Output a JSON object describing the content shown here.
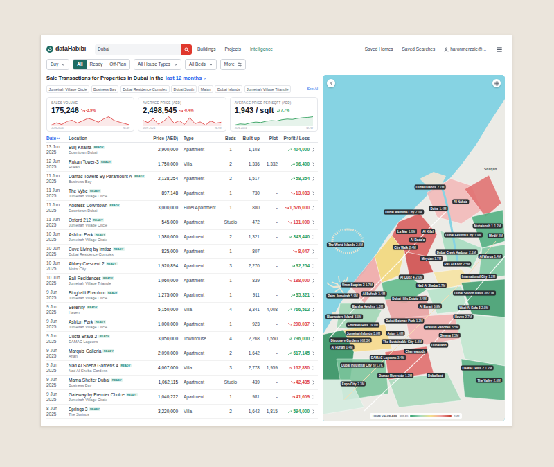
{
  "brand": {
    "name": "dataHabibi"
  },
  "search": {
    "value": "Dubai"
  },
  "nav": [
    {
      "label": "Buildings",
      "selected": false
    },
    {
      "label": "Projects",
      "selected": false
    },
    {
      "label": "Intelligence",
      "selected": true
    }
  ],
  "account": {
    "links": [
      "Saved Homes",
      "Saved Searches"
    ],
    "user": "haronmerzaie@..."
  },
  "filters": {
    "deal": "Buy",
    "statuses": [
      {
        "label": "All",
        "selected": true
      },
      {
        "label": "Ready",
        "selected": false
      },
      {
        "label": "Off-Plan",
        "selected": false
      }
    ],
    "dropdowns": [
      "All House Types",
      "All Beds"
    ],
    "more": "More"
  },
  "heading": {
    "text": "Sale Transactions for Properties in Dubai in the",
    "period": "last 12 months"
  },
  "chips": [
    "Jumeirah Village Circle",
    "Business Bay",
    "Dubai Residence Complex",
    "Dubai South",
    "Majan",
    "Dubai Islands",
    "Jumeirah Village Triangle"
  ],
  "see_all": "See Al",
  "stats": [
    {
      "label": "SALES VOLUME",
      "value": "175,246",
      "change": "-3.9%",
      "trend": "down",
      "color": "#e04848",
      "axis_start": "JUN 2024",
      "axis_end": "NOW",
      "series": [
        12800,
        13900,
        13100,
        14600,
        15200,
        13800,
        14900,
        16100,
        15400,
        14200,
        15800,
        16900,
        15100,
        14300,
        13600,
        12900
      ]
    },
    {
      "label": "AVERAGE PRICE (AED)",
      "value": "2,498,545",
      "change": "-0.4%",
      "trend": "down",
      "color": "#e04848",
      "axis_start": "JUN 2024",
      "axis_end": "NOW",
      "series": [
        2540000,
        2490000,
        2575000,
        2460000,
        2520000,
        2610000,
        2480000,
        2530000,
        2455000,
        2590000,
        2470000,
        2505000,
        2440000,
        2525000,
        2480000,
        2498545
      ]
    },
    {
      "label": "AVERAGE PRICE PER SQFT (AED)",
      "value": "1,943 / sqft",
      "change": "7.7%",
      "trend": "up",
      "color": "#2f9e5b",
      "axis_start": "JUN 2024",
      "axis_end": "NOW",
      "series": [
        1790,
        1812,
        1805,
        1830,
        1846,
        1838,
        1861,
        1872,
        1866,
        1889,
        1901,
        1895,
        1912,
        1925,
        1931,
        1943
      ]
    }
  ],
  "table": {
    "columns": [
      {
        "label": "Date",
        "sorted": true
      },
      {
        "label": "Location",
        "sorted": false
      },
      {
        "label": "Price (AED)",
        "sorted": false
      },
      {
        "label": "Type",
        "sorted": false
      },
      {
        "label": "Beds",
        "sorted": false
      },
      {
        "label": "Built-up",
        "sorted": false
      },
      {
        "label": "Plot",
        "sorted": false
      },
      {
        "label": "Profit / Loss",
        "sorted": false
      }
    ],
    "rows": [
      {
        "date": "13 Jun",
        "year": "2025",
        "name": "Burj Khalifa",
        "badge": "READY",
        "area": "Downtown Dubai",
        "price": "2,900,000",
        "type": "Apartment",
        "beds": "1",
        "built_up": "1,103",
        "plot": "-",
        "profit": "404,000",
        "kind": "profit"
      },
      {
        "date": "12 Jun",
        "year": "2025",
        "name": "Rukan Tower-3",
        "badge": "READY",
        "area": "Rukan",
        "price": "1,750,000",
        "type": "Villa",
        "beds": "2",
        "built_up": "1,336",
        "plot": "1,332",
        "profit": "96,400",
        "kind": "profit"
      },
      {
        "date": "11 Jun",
        "year": "2025",
        "name": "Damac Towers By Paramount A",
        "badge": "READY",
        "area": "Business Bay",
        "price": "2,138,254",
        "type": "Apartment",
        "beds": "2",
        "built_up": "1,517",
        "plot": "-",
        "profit": "58,254",
        "kind": "profit"
      },
      {
        "date": "11 Jun",
        "year": "2025",
        "name": "The Vybe",
        "badge": "READY",
        "area": "Jumeirah Village Circle",
        "price": "897,148",
        "type": "Apartment",
        "beds": "1",
        "built_up": "730",
        "plot": "-",
        "profit": "13,083",
        "kind": "loss"
      },
      {
        "date": "11 Jun",
        "year": "2025",
        "name": "Address Downtown",
        "badge": "READY",
        "area": "Downtown Dubai",
        "price": "3,000,000",
        "type": "Hotel Apartment",
        "beds": "1",
        "built_up": "880",
        "plot": "-",
        "profit": "1,576,000",
        "kind": "loss"
      },
      {
        "date": "11 Jun",
        "year": "2025",
        "name": "Oxford 212",
        "badge": "READY",
        "area": "Jumeirah Village Circle",
        "price": "545,000",
        "type": "Apartment",
        "beds": "Studio",
        "built_up": "472",
        "plot": "-",
        "profit": "131,000",
        "kind": "loss"
      },
      {
        "date": "10 Jun",
        "year": "2025",
        "name": "Ashton Park",
        "badge": "READY",
        "area": "Jumeirah Village Circle",
        "price": "1,580,000",
        "type": "Apartment",
        "beds": "2",
        "built_up": "1,321",
        "plot": "-",
        "profit": "343,440",
        "kind": "profit"
      },
      {
        "date": "10 Jun",
        "year": "2025",
        "name": "Cove Living by Imtiaz",
        "badge": "READY",
        "area": "Dubai Residence Complex",
        "price": "825,000",
        "type": "Apartment",
        "beds": "1",
        "built_up": "807",
        "plot": "-",
        "profit": "8,047",
        "kind": "loss"
      },
      {
        "date": "10 Jun",
        "year": "2025",
        "name": "Abbey Crescent 2",
        "badge": "READY",
        "area": "Motor City",
        "price": "1,920,894",
        "type": "Apartment",
        "beds": "3",
        "built_up": "2,270",
        "plot": "-",
        "profit": "32,254",
        "kind": "profit"
      },
      {
        "date": "10 Jun",
        "year": "2025",
        "name": "Bali Residences",
        "badge": "READY",
        "area": "Jumeirah Village Triangle",
        "price": "1,060,000",
        "type": "Apartment",
        "beds": "1",
        "built_up": "839",
        "plot": "-",
        "profit": "188,000",
        "kind": "loss"
      },
      {
        "date": "9 Jun",
        "year": "2025",
        "name": "Binghatti Phantom",
        "badge": "READY",
        "area": "Jumeirah Village Circle",
        "price": "1,275,000",
        "type": "Apartment",
        "beds": "1",
        "built_up": "911",
        "plot": "-",
        "profit": "35,321",
        "kind": "profit"
      },
      {
        "date": "9 Jun",
        "year": "2025",
        "name": "Serenity",
        "badge": "READY",
        "area": "Haven",
        "price": "5,150,000",
        "type": "Villa",
        "beds": "4",
        "built_up": "3,341",
        "plot": "4,008",
        "profit": "766,512",
        "kind": "profit"
      },
      {
        "date": "9 Jun",
        "year": "2025",
        "name": "Ashton Park",
        "badge": "READY",
        "area": "Jumeirah Village Circle",
        "price": "1,000,000",
        "type": "Apartment",
        "beds": "1",
        "built_up": "923",
        "plot": "-",
        "profit": "200,087",
        "kind": "loss"
      },
      {
        "date": "9 Jun",
        "year": "2025",
        "name": "Costa Brava 2",
        "badge": "READY",
        "area": "DAMAC Lagoons",
        "price": "3,050,000",
        "type": "Townhouse",
        "beds": "4",
        "built_up": "2,268",
        "plot": "1,550",
        "profit": "736,000",
        "kind": "profit"
      },
      {
        "date": "9 Jun",
        "year": "2025",
        "name": "Marquis Galleria",
        "badge": "READY",
        "area": "Arjan",
        "price": "2,090,000",
        "type": "Apartment",
        "beds": "2",
        "built_up": "1,642",
        "plot": "-",
        "profit": "617,145",
        "kind": "profit"
      },
      {
        "date": "9 Jun",
        "year": "2025",
        "name": "Nad Al Sheba Gardens 4",
        "badge": "READY",
        "area": "Nad Al Sheba Gardens",
        "price": "4,067,000",
        "type": "Villa",
        "beds": "3",
        "built_up": "2,778",
        "plot": "1,959",
        "profit": "162,880",
        "kind": "loss"
      },
      {
        "date": "9 Jun",
        "year": "2025",
        "name": "Mama Shelter Dubai",
        "badge": "READY",
        "area": "Business Bay",
        "price": "1,062,115",
        "type": "Apartment",
        "beds": "Studio",
        "built_up": "439",
        "plot": "-",
        "profit": "42,485",
        "kind": "loss"
      },
      {
        "date": "9 Jun",
        "year": "2025",
        "name": "Gateway by Premier Choice",
        "badge": "READY",
        "area": "Jumeirah Village Circle",
        "price": "1,040,222",
        "type": "Apartment",
        "beds": "1",
        "built_up": "981",
        "plot": "-",
        "profit": "41,609",
        "kind": "loss"
      },
      {
        "date": "8 Jun",
        "year": "2025",
        "name": "Springs 3",
        "badge": "READY",
        "area": "The Springs",
        "price": "3,220,000",
        "type": "Villa",
        "beds": "2",
        "built_up": "1,642",
        "plot": "1,815",
        "profit": "594,000",
        "kind": "profit"
      }
    ]
  },
  "map": {
    "places": [
      "Sharjah"
    ],
    "pins": [
      {
        "name": "Dubai Islands",
        "value": "2.7M"
      },
      {
        "name": "Al Nahda",
        "value": ""
      },
      {
        "name": "Dubai Maritime City",
        "value": "2.0M"
      },
      {
        "name": "Deira",
        "value": "1.4M"
      },
      {
        "name": "Muhaisnah 1",
        "value": "1.2M"
      },
      {
        "name": "La Mer",
        "value": "1.6M"
      },
      {
        "name": "Al Kifaf",
        "value": ""
      },
      {
        "name": "Dubai Festival City",
        "value": "1.9M"
      },
      {
        "name": "Mirdif",
        "value": "2M"
      },
      {
        "name": "The World Islands",
        "value": "2.5M"
      },
      {
        "name": "Al Bada'a",
        "value": ""
      },
      {
        "name": "City Walk",
        "value": "2.4M"
      },
      {
        "name": "Dubai Creek Harbour",
        "value": "2.1M"
      },
      {
        "name": "Al Warqa",
        "value": "1.4M"
      },
      {
        "name": "Meydan",
        "value": "1.7M"
      },
      {
        "name": "Ras Al Khor",
        "value": "2.5M"
      },
      {
        "name": "Al Quoz 4",
        "value": "2.0M"
      },
      {
        "name": "International City",
        "value": "1.2M"
      },
      {
        "name": "Umm Suqeim 3",
        "value": "1.7M"
      },
      {
        "name": "Nad Al Sheba",
        "value": "3.7M"
      },
      {
        "name": "Al Sufouh",
        "value": "3.4M"
      },
      {
        "name": "Palm Jumeirah",
        "value": "5.9M"
      },
      {
        "name": "Dubai Silicon Oasis",
        "value": "867.1K"
      },
      {
        "name": "Dubai Hills Estate",
        "value": "2.4M"
      },
      {
        "name": "Barsha Heights",
        "value": "1.3M"
      },
      {
        "name": "Al Barari",
        "value": "6.9M"
      },
      {
        "name": "Wadi Al Safa 3",
        "value": "2.0M"
      },
      {
        "name": "Bluewaters Island",
        "value": "3.9M"
      },
      {
        "name": "Haven",
        "value": "2.7M"
      },
      {
        "name": "Dubai Science Park",
        "value": "1.3M"
      },
      {
        "name": "Emirates Hills",
        "value": "19.9M"
      },
      {
        "name": "Arabian Ranches",
        "value": "5.5M"
      },
      {
        "name": "Jumeirah Islands",
        "value": "3.9M"
      },
      {
        "name": "Arjan",
        "value": "1.6M"
      },
      {
        "name": "Serena",
        "value": "2.5M"
      },
      {
        "name": "Discovery Gardens",
        "value": "962.3K"
      },
      {
        "name": "The Sustainable City",
        "value": "1.6M"
      },
      {
        "name": "Dubailand",
        "value": ""
      },
      {
        "name": "Al Furjan",
        "value": "1.4M"
      },
      {
        "name": "Cherrywoods",
        "value": ""
      },
      {
        "name": "DAMAC Lagoons",
        "value": "3.4M"
      },
      {
        "name": "Dubai Industrial City",
        "value": "671.7K"
      },
      {
        "name": "DAMAC Hills 2",
        "value": "1.2M"
      },
      {
        "name": "Damac Riverside",
        "value": "1.3M"
      },
      {
        "name": "Dubailand",
        "value": ""
      },
      {
        "name": "The Valley",
        "value": "2.6M"
      },
      {
        "name": "Expo City",
        "value": "2.3M"
      }
    ],
    "legend": {
      "title": "HOME VALUE AED",
      "min": "388.1K",
      "max": "90M"
    }
  }
}
